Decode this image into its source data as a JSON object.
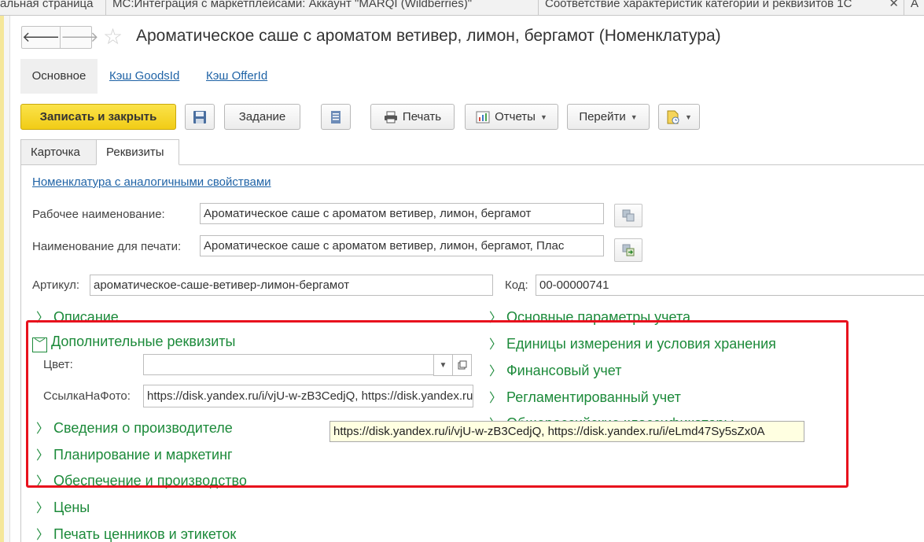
{
  "window_tabs": [
    {
      "label": "альная страница"
    },
    {
      "label": "МС:Интеграция с маркетплейсами: Аккаунт \"MARQI (Wildberries)\""
    },
    {
      "label": "Соответствие характеристик категории и реквизитов 1С"
    },
    {
      "label": "А"
    }
  ],
  "header": {
    "title": "Ароматическое саше с ароматом ветивер, лимон, бергамот (Номенклатура)"
  },
  "form_tabs": {
    "main": "Основное",
    "cache_goods": "Кэш GoodsId",
    "cache_offer": "Кэш OfferId"
  },
  "toolbar": {
    "save_close": "Записать и закрыть",
    "task": "Задание",
    "print": "Печать",
    "reports": "Отчеты",
    "goto": "Перейти"
  },
  "content_tabs": {
    "card": "Карточка",
    "requisites": "Реквизиты"
  },
  "links": {
    "similar": "Номенклатура с аналогичными свойствами"
  },
  "fields": {
    "work_name": {
      "label": "Рабочее наименование:",
      "value": "Ароматическое саше с ароматом ветивер, лимон, бергамот"
    },
    "print_name": {
      "label": "Наименование для печати:",
      "value": "Ароматическое саше с ароматом ветивер, лимон, бергамот, Плас"
    },
    "article": {
      "label": "Артикул:",
      "value": "ароматическое-саше-ветивер-лимон-бергамот"
    },
    "code": {
      "label": "Код:",
      "value": "00-00000741"
    },
    "color": {
      "label": "Цвет:",
      "value": ""
    },
    "photo_link": {
      "label": "СсылкаНаФото:",
      "value": "https://disk.yandex.ru/i/vjU-w-zB3CedjQ, https://disk.yandex.ru/i/eLmd47Sy5sZx0A"
    }
  },
  "groups_left": {
    "description": "Описание",
    "additional": "Дополнительные реквизиты",
    "manufacturer": "Сведения о производителе",
    "planning": "Планирование и маркетинг",
    "supply": "Обеспечение и производство",
    "prices": "Цены",
    "labels": "Печать ценников и этикеток"
  },
  "groups_right": {
    "accounting_params": "Основные параметры учета",
    "units": "Единицы измерения и условия хранения",
    "financial": "Финансовый учет",
    "regulated": "Регламентированный учет",
    "classifiers": "Общероссийские классификаторы"
  },
  "tooltip": {
    "text": "https://disk.yandex.ru/i/vjU-w-zB3CedjQ, https://disk.yandex.ru/i/eLmd47Sy5sZx0A"
  },
  "colors": {
    "accent_green": "#1c8a3a",
    "link_blue": "#1f63a6",
    "primary_yellow": "#f5d321",
    "highlight_red": "#e8111d"
  }
}
